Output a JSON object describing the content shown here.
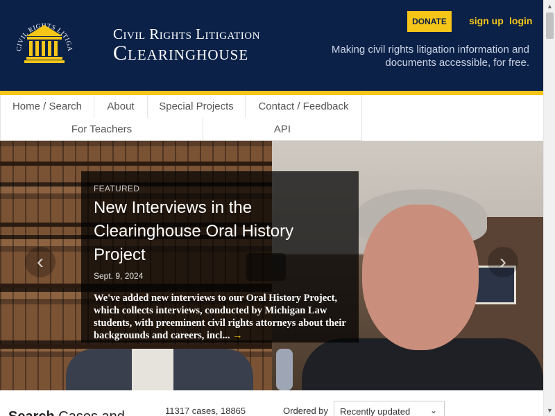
{
  "header": {
    "seal_text": "CIVIL RIGHTS LITIGATION CLEARINGHOUSE",
    "brand_top": "Civil Rights Litigation",
    "brand_bottom": "Clearinghouse",
    "donate_label": "DONATE",
    "signup_label": "sign up",
    "login_label": "login",
    "tagline": "Making civil rights litigation information and documents accessible, for free."
  },
  "nav": {
    "items": [
      {
        "label": "Home / Search"
      },
      {
        "label": "About"
      },
      {
        "label": "Special Projects"
      },
      {
        "label": "Contact / Feedback"
      },
      {
        "label": "For Teachers"
      },
      {
        "label": "API"
      }
    ]
  },
  "featured": {
    "kicker": "FEATURED",
    "title": "New Interviews in the Clearinghouse Oral History Project",
    "date": "Sept. 9, 2024",
    "body": "We've added new interviews to our Oral History Project, which collects interviews, conducted by Michigan Law students, with preeminent civil rights attorneys about their backgrounds and careers, incl...",
    "arrow": "→"
  },
  "carousel": {
    "prev_icon": "‹",
    "next_icon": "›"
  },
  "search": {
    "heading_bold": "Search",
    "heading_light": "Cases and",
    "count_text": "11317 cases, 18865",
    "ordered_label": "Ordered by",
    "sort_value": "Recently updated",
    "sort_chevron": "⌄"
  },
  "colors": {
    "navy": "#0b2148",
    "gold": "#f5c518"
  },
  "scrollbar": {
    "up_icon": "▲",
    "down_icon": "▼"
  }
}
